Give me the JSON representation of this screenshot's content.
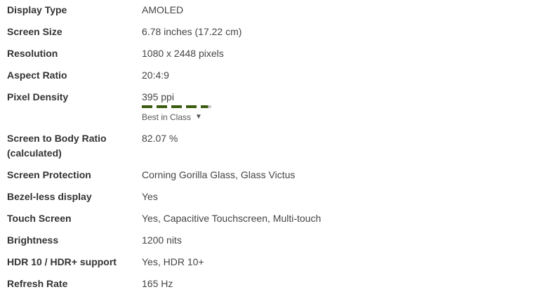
{
  "specs": [
    {
      "label": "Display Type",
      "value": "AMOLED"
    },
    {
      "label": "Screen Size",
      "value": "6.78 inches (17.22 cm)"
    },
    {
      "label": "Resolution",
      "value": "1080 x 2448 pixels"
    },
    {
      "label": "Aspect Ratio",
      "value": "20:4:9"
    },
    {
      "label": "Pixel Density",
      "value": "395 ppi",
      "rating_fraction": 0.95,
      "rating_text": "Best in Class",
      "rating_caret": "▼"
    },
    {
      "label_line1": "Screen to Body Ratio",
      "label_line2": "(calculated)",
      "value": "82.07 %"
    },
    {
      "label": "Screen Protection",
      "value": "Corning Gorilla Glass, Glass Victus"
    },
    {
      "label": "Bezel-less display",
      "value": "Yes"
    },
    {
      "label": "Touch Screen",
      "value": "Yes, Capacitive Touchscreen, Multi-touch"
    },
    {
      "label": "Brightness",
      "value": "1200 nits"
    },
    {
      "label": "HDR 10 / HDR+ support",
      "value": "Yes, HDR 10+"
    },
    {
      "label": "Refresh Rate",
      "value": "165 Hz"
    }
  ],
  "colors": {
    "rating_fill": "#3b5c0f",
    "rating_empty": "#cccccc"
  }
}
